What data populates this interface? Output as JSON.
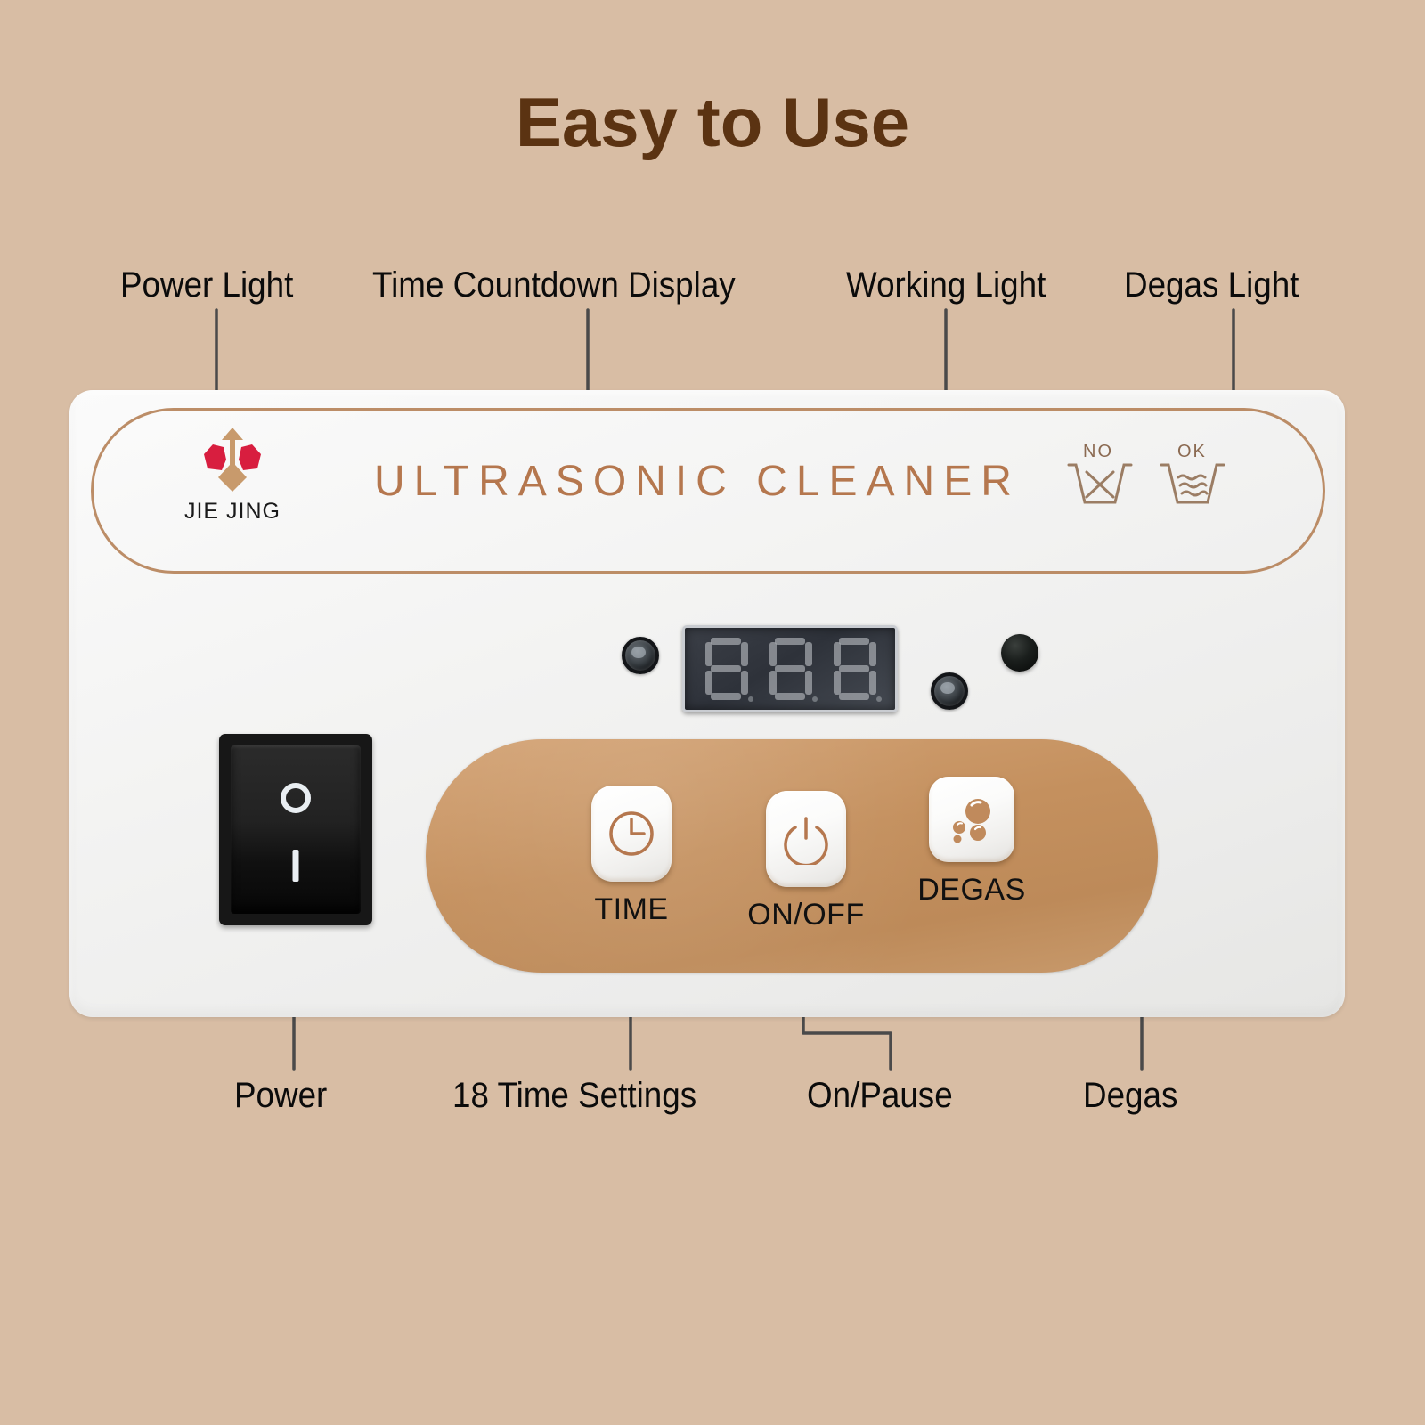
{
  "page": {
    "title": "Easy to Use",
    "background_color": "#d8bda4",
    "title_color": "#5b3312"
  },
  "callouts": {
    "top": [
      {
        "label": "Power Light",
        "target": "power-light"
      },
      {
        "label": "Time Countdown Display",
        "target": "time-countdown-display"
      },
      {
        "label": "Working Light",
        "target": "working-light"
      },
      {
        "label": "Degas Light",
        "target": "degas-light"
      }
    ],
    "bottom": [
      {
        "label": "Power",
        "target": "power-rocker-switch"
      },
      {
        "label": "18 Time Settings",
        "target": "time-button"
      },
      {
        "label": "On/Pause",
        "target": "onoff-button"
      },
      {
        "label": "Degas",
        "target": "degas-button"
      }
    ]
  },
  "device": {
    "brand_name": "JIE JING",
    "product_name": "ULTRASONIC CLEANER",
    "accent_color": "#b5774e",
    "logo_red": "#d81e3f",
    "logo_gold": "#c89a6c",
    "basin_icons": [
      {
        "label": "NO",
        "icon": "basin-no-icon"
      },
      {
        "label": "OK",
        "icon": "basin-ok-icon"
      }
    ],
    "display": {
      "digits": [
        "8",
        "8",
        "8"
      ],
      "lit": false
    },
    "indicators": [
      {
        "name": "power-light",
        "style": "ring"
      },
      {
        "name": "working-light",
        "style": "ring"
      },
      {
        "name": "degas-light",
        "style": "solid"
      }
    ],
    "rocker": {
      "off_symbol": "O",
      "on_symbol": "I"
    },
    "buttons": [
      {
        "label": "TIME",
        "icon": "clock-icon"
      },
      {
        "label": "ON/OFF",
        "icon": "power-icon"
      },
      {
        "label": "DEGAS",
        "icon": "bubbles-icon"
      }
    ]
  }
}
